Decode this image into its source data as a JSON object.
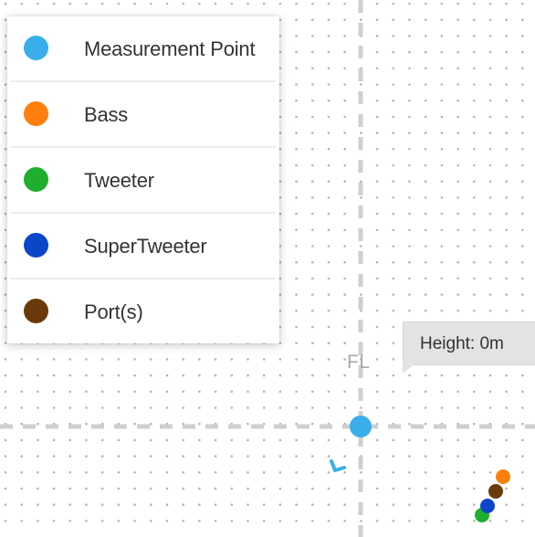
{
  "legend": {
    "items": [
      {
        "key": "measurement_point",
        "label": "Measurement Point",
        "color": "#3aaeea"
      },
      {
        "key": "bass",
        "label": "Bass",
        "color": "#ff7f0e"
      },
      {
        "key": "tweeter",
        "label": "Tweeter",
        "color": "#1fae2e"
      },
      {
        "key": "super_tweeter",
        "label": "SuperTweeter",
        "color": "#0b46c8"
      },
      {
        "key": "ports",
        "label": "Port(s)",
        "color": "#6b3a0c"
      }
    ]
  },
  "height_tooltip": {
    "text": "Height: 0m"
  },
  "speaker": {
    "label": "FL"
  },
  "colors": {
    "grid_dot": "#b5b5b5",
    "axis_line": "#cfcfcf",
    "measurement_point": "#3aaeea",
    "listener_marker": "#3aaeea"
  }
}
